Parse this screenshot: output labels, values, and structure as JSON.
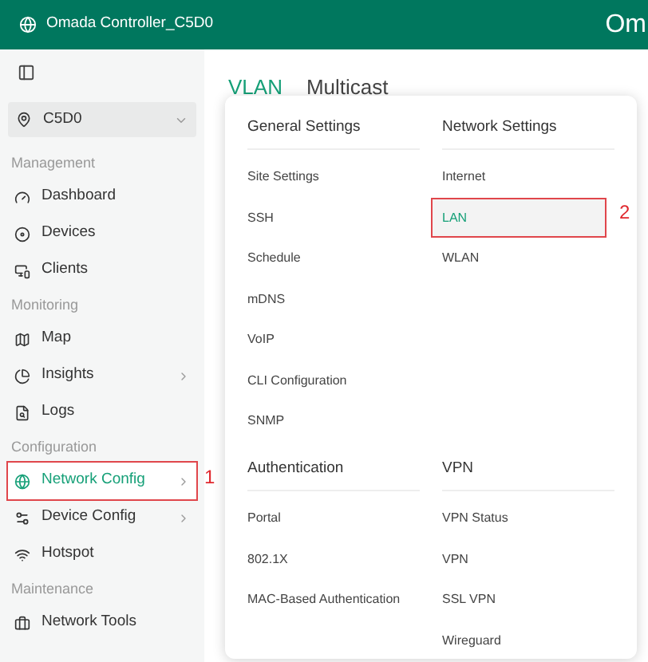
{
  "header": {
    "title": "Omada Controller_C5D0",
    "brand": "Om"
  },
  "site": {
    "name": "C5D0"
  },
  "sidebar": {
    "groups": [
      {
        "title": "Management",
        "items": [
          {
            "label": "Dashboard",
            "has_submenu": false,
            "selected": false
          },
          {
            "label": "Devices",
            "has_submenu": false,
            "selected": false
          },
          {
            "label": "Clients",
            "has_submenu": false,
            "selected": false
          }
        ]
      },
      {
        "title": "Monitoring",
        "items": [
          {
            "label": "Map",
            "has_submenu": false,
            "selected": false
          },
          {
            "label": "Insights",
            "has_submenu": true,
            "selected": false
          },
          {
            "label": "Logs",
            "has_submenu": false,
            "selected": false
          }
        ]
      },
      {
        "title": "Configuration",
        "items": [
          {
            "label": "Network Config",
            "has_submenu": true,
            "selected": true,
            "callout": "1"
          },
          {
            "label": "Device Config",
            "has_submenu": true,
            "selected": false
          },
          {
            "label": "Hotspot",
            "has_submenu": false,
            "selected": false
          }
        ]
      },
      {
        "title": "Maintenance",
        "items": [
          {
            "label": "Network Tools",
            "has_submenu": false,
            "selected": false
          }
        ]
      }
    ]
  },
  "tabs": [
    {
      "label": "VLAN",
      "selected": true
    },
    {
      "label": "Multicast",
      "selected": false
    }
  ],
  "menu": {
    "sections": [
      {
        "title": "General Settings",
        "items": [
          {
            "label": "Site Settings",
            "selected": false
          },
          {
            "label": "SSH",
            "selected": false
          },
          {
            "label": "Schedule",
            "selected": false
          },
          {
            "label": "mDNS",
            "selected": false
          },
          {
            "label": "VoIP",
            "selected": false
          },
          {
            "label": "CLI Configuration",
            "selected": false
          },
          {
            "label": "SNMP",
            "selected": false
          }
        ]
      },
      {
        "title": "Network Settings",
        "items": [
          {
            "label": "Internet",
            "selected": false
          },
          {
            "label": "LAN",
            "selected": true,
            "callout": "2"
          },
          {
            "label": "WLAN",
            "selected": false
          }
        ]
      },
      {
        "title": "Authentication",
        "items": [
          {
            "label": "Portal",
            "selected": false
          },
          {
            "label": "802.1X",
            "selected": false
          },
          {
            "label": "MAC-Based Authentication",
            "selected": false
          }
        ]
      },
      {
        "title": "VPN",
        "items": [
          {
            "label": "VPN Status",
            "selected": false
          },
          {
            "label": "VPN",
            "selected": false
          },
          {
            "label": "SSL VPN",
            "selected": false
          },
          {
            "label": "Wireguard",
            "selected": false
          }
        ]
      }
    ]
  }
}
